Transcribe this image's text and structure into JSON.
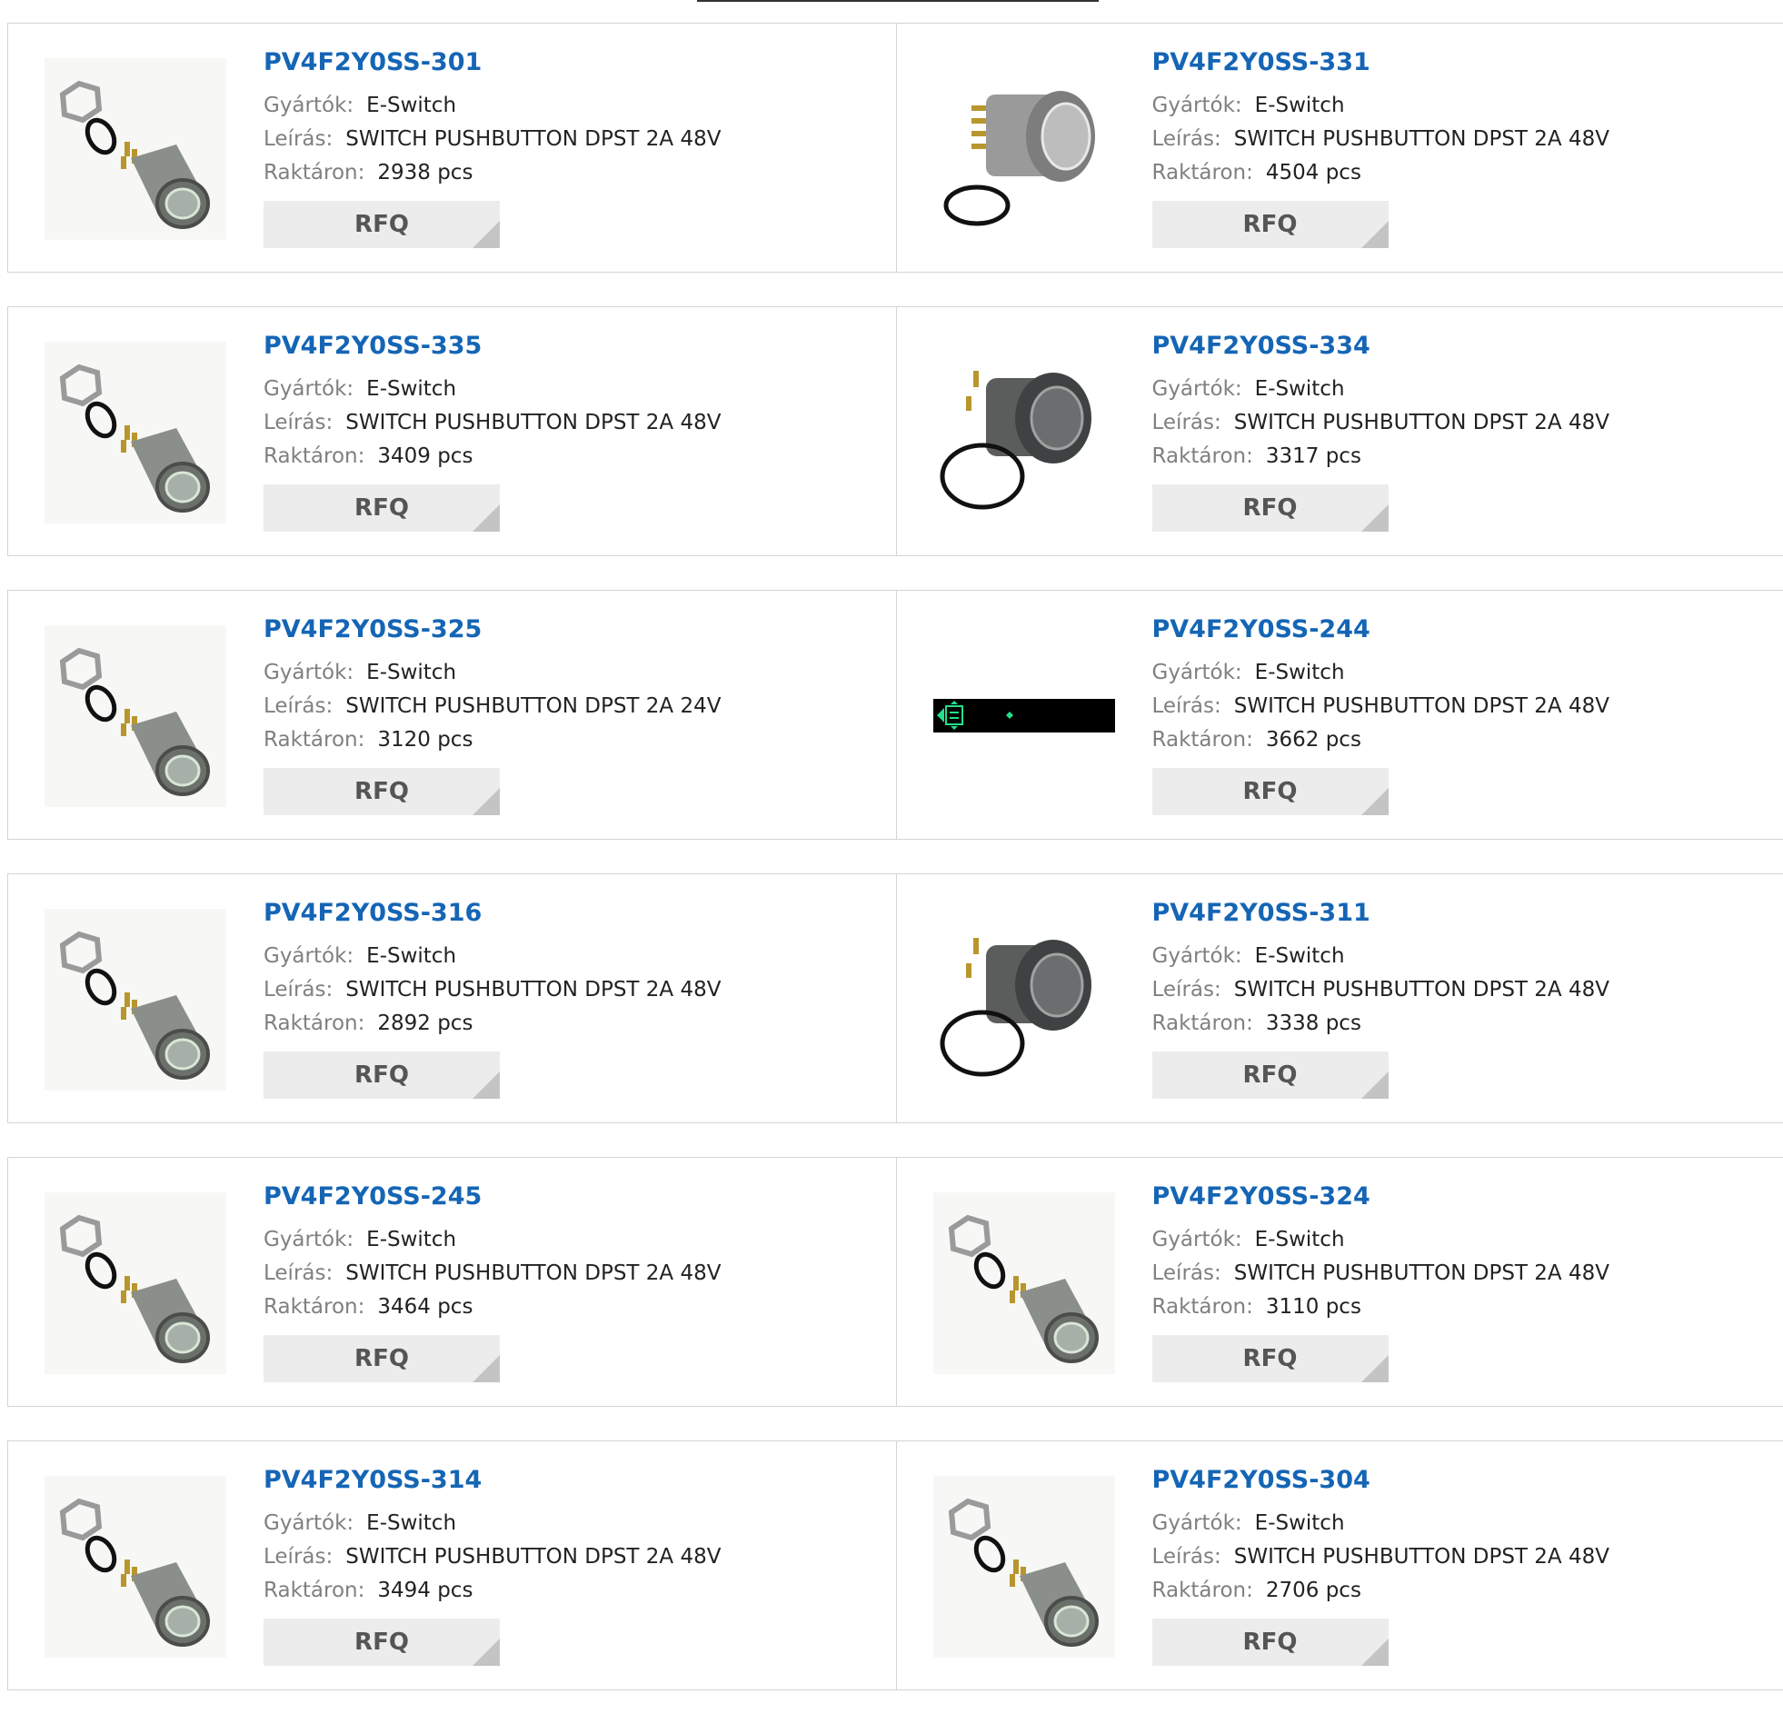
{
  "labels": {
    "manufacturer": "Gyártók:",
    "description": "Leírás:",
    "stock": "Raktáron:",
    "rfq": "RFQ"
  },
  "products": [
    {
      "part": "PV4F2Y0SS-301",
      "manufacturer": "E-Switch",
      "description": "SWITCH PUSHBUTTON DPST 2A 48V",
      "stock": "2938 pcs",
      "image": "exploded-switch-icon"
    },
    {
      "part": "PV4F2Y0SS-331",
      "manufacturer": "E-Switch",
      "description": "SWITCH PUSHBUTTON DPST 2A 48V",
      "stock": "4504 pcs",
      "image": "switch-side-icon"
    },
    {
      "part": "PV4F2Y0SS-335",
      "manufacturer": "E-Switch",
      "description": "SWITCH PUSHBUTTON DPST 2A 48V",
      "stock": "3409 pcs",
      "image": "exploded-switch-icon"
    },
    {
      "part": "PV4F2Y0SS-334",
      "manufacturer": "E-Switch",
      "description": "SWITCH PUSHBUTTON DPST 2A 48V",
      "stock": "3317 pcs",
      "image": "switch-side-dark-icon"
    },
    {
      "part": "PV4F2Y0SS-325",
      "manufacturer": "E-Switch",
      "description": "SWITCH PUSHBUTTON DPST 2A 24V",
      "stock": "3120 pcs",
      "image": "exploded-switch-icon"
    },
    {
      "part": "PV4F2Y0SS-244",
      "manufacturer": "E-Switch",
      "description": "SWITCH PUSHBUTTON DPST 2A 48V",
      "stock": "3662 pcs",
      "image": "placeholder-bar-icon"
    },
    {
      "part": "PV4F2Y0SS-316",
      "manufacturer": "E-Switch",
      "description": "SWITCH PUSHBUTTON DPST 2A 48V",
      "stock": "2892 pcs",
      "image": "exploded-switch-icon"
    },
    {
      "part": "PV4F2Y0SS-311",
      "manufacturer": "E-Switch",
      "description": "SWITCH PUSHBUTTON DPST 2A 48V",
      "stock": "3338 pcs",
      "image": "switch-side-dark-icon"
    },
    {
      "part": "PV4F2Y0SS-245",
      "manufacturer": "E-Switch",
      "description": "SWITCH PUSHBUTTON DPST 2A 48V",
      "stock": "3464 pcs",
      "image": "exploded-switch-icon"
    },
    {
      "part": "PV4F2Y0SS-324",
      "manufacturer": "E-Switch",
      "description": "SWITCH PUSHBUTTON DPST 2A 48V",
      "stock": "3110 pcs",
      "image": "exploded-switch-icon"
    },
    {
      "part": "PV4F2Y0SS-314",
      "manufacturer": "E-Switch",
      "description": "SWITCH PUSHBUTTON DPST 2A 48V",
      "stock": "3494 pcs",
      "image": "exploded-switch-icon"
    },
    {
      "part": "PV4F2Y0SS-304",
      "manufacturer": "E-Switch",
      "description": "SWITCH PUSHBUTTON DPST 2A 48V",
      "stock": "2706 pcs",
      "image": "exploded-switch-icon"
    }
  ],
  "colors": {
    "part_link": "#1565b5",
    "label": "#808080",
    "rfq_bg": "#ececec",
    "border": "#d4d4d4"
  }
}
